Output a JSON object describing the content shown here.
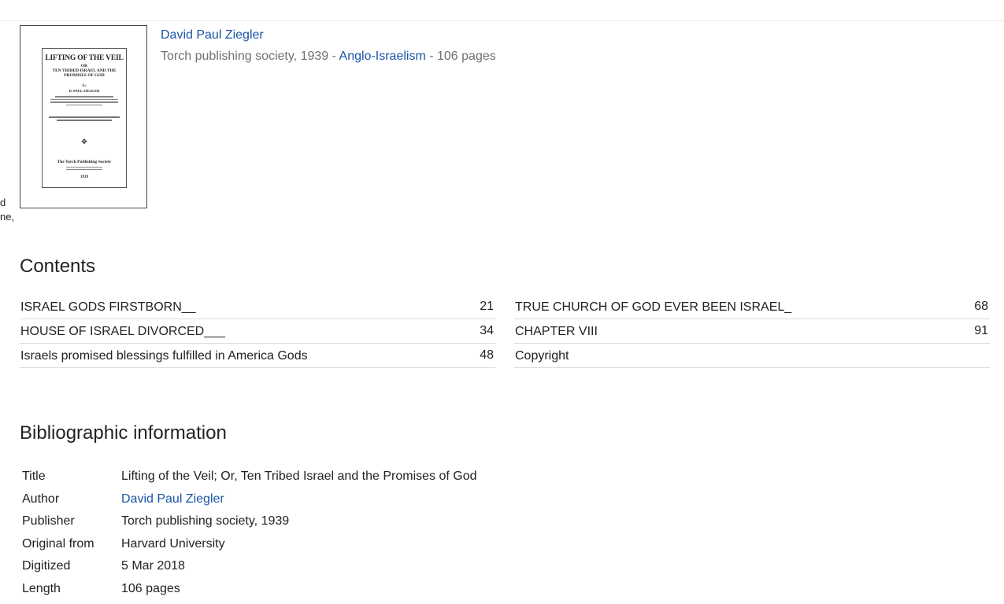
{
  "left_fragments": [
    "d",
    "ne,"
  ],
  "cover": {
    "title": "LIFTING OF THE VEIL",
    "subtitle_line1": "OR",
    "subtitle_line2": "TEN TRIBED ISRAEL AND THE",
    "subtitle_line3": "PROMISES OF GOD",
    "by": "By",
    "author": "D. PAUL ZIEGLER",
    "ornament": "✥",
    "publisher": "The Torch Publishing Society",
    "year": "1939"
  },
  "book": {
    "author": "David Paul Ziegler",
    "publisher_year": "Torch publishing society, 1939",
    "sep1": " - ",
    "subject": "Anglo-Israelism",
    "sep2": " - ",
    "pages": "106 pages"
  },
  "contents": {
    "heading": "Contents",
    "left": [
      {
        "title": "ISRAEL GODS FIRSTBORN__",
        "page": "21"
      },
      {
        "title": "HOUSE OF ISRAEL DIVORCED___",
        "page": "34"
      },
      {
        "title": "Israels promised blessings fulfilled in America Gods",
        "page": "48"
      }
    ],
    "right": [
      {
        "title": "TRUE CHURCH OF GOD EVER BEEN ISRAEL_",
        "page": "68"
      },
      {
        "title": "CHAPTER VIII",
        "page": "91"
      },
      {
        "title": "Copyright",
        "page": ""
      }
    ]
  },
  "bibliographic": {
    "heading": "Bibliographic information",
    "rows": [
      {
        "label": "Title",
        "value": "Lifting of the Veil; Or, Ten Tribed Israel and the Promises of God"
      },
      {
        "label": "Author",
        "value": "David Paul Ziegler"
      },
      {
        "label": "Publisher",
        "value": "Torch publishing society, 1939"
      },
      {
        "label": "Original from",
        "value": "Harvard University"
      },
      {
        "label": "Digitized",
        "value": "5 Mar 2018"
      },
      {
        "label": "Length",
        "value": "106 pages"
      }
    ]
  },
  "colors": {
    "link": "#1a55a5",
    "muted": "#707070",
    "text": "#222222"
  }
}
